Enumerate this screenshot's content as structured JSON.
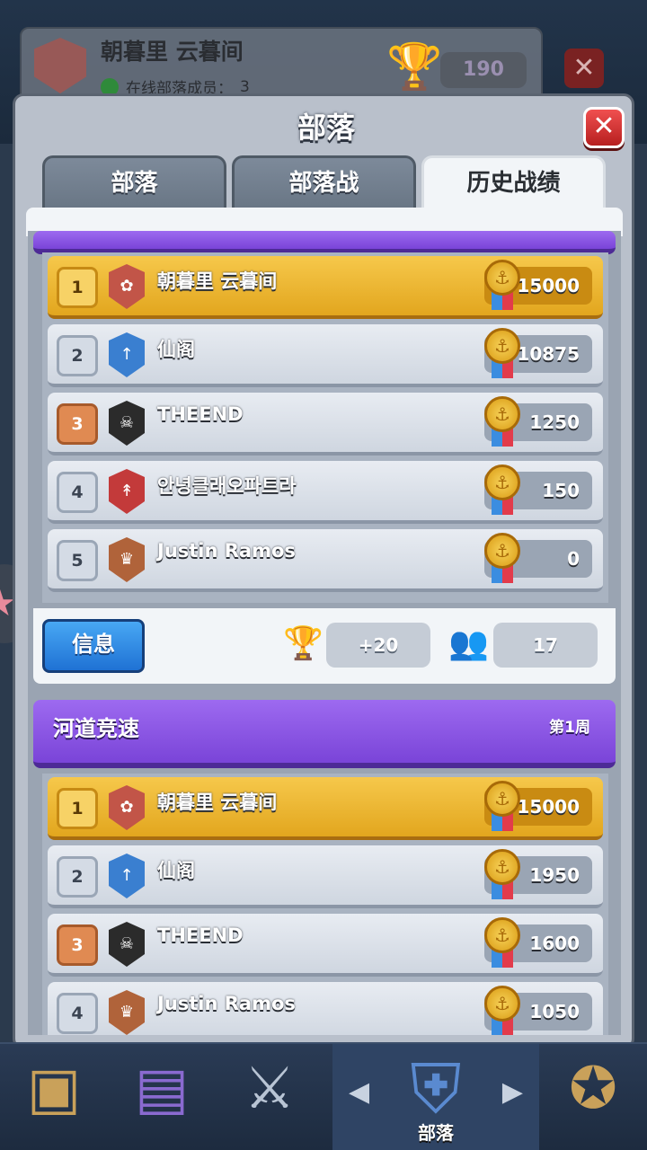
{
  "background": {
    "clan_name": "朝暮里 云暮间",
    "online_label": "在线部落成员：",
    "online_count": "3",
    "trophies": "190"
  },
  "modal": {
    "title": "部落",
    "tabs": [
      {
        "label": "部落"
      },
      {
        "label": "部落战"
      },
      {
        "label": "历史战绩"
      }
    ],
    "active_tab": "历史战绩"
  },
  "season1": {
    "rows": [
      {
        "rank": "1",
        "name": "朝暮里 云暮间",
        "score": "15000"
      },
      {
        "rank": "2",
        "name": "仙阁",
        "score": "10875"
      },
      {
        "rank": "3",
        "name": "THEEND",
        "score": "1250"
      },
      {
        "rank": "4",
        "name": "안녕클래오파트라",
        "score": "150"
      },
      {
        "rank": "5",
        "name": "Justin Ramos",
        "score": "0"
      }
    ],
    "info_button": "信息",
    "trophy_change": "+20",
    "members": "17"
  },
  "season2": {
    "title": "河道竞速",
    "week": "第1周",
    "rows": [
      {
        "rank": "1",
        "name": "朝暮里 云暮间",
        "score": "15000"
      },
      {
        "rank": "2",
        "name": "仙阁",
        "score": "1950"
      },
      {
        "rank": "3",
        "name": "THEEND",
        "score": "1600"
      },
      {
        "rank": "4",
        "name": "Justin Ramos",
        "score": "1050"
      }
    ]
  },
  "nav": {
    "active_label": "部落"
  },
  "colors": {
    "gold_row": "#f6c84b",
    "purple_header": "#8a55e6",
    "blue_button": "#2f8ae6"
  }
}
